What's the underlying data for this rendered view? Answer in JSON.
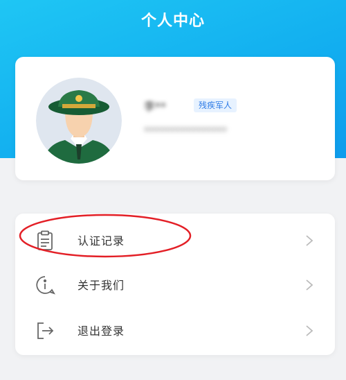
{
  "header": {
    "title": "个人中心"
  },
  "profile": {
    "name": "李**",
    "tag": "残疾军人",
    "id_number": "****************"
  },
  "menu": {
    "items": [
      {
        "label": "认证记录",
        "icon": "clipboard-icon"
      },
      {
        "label": "关于我们",
        "icon": "info-icon"
      },
      {
        "label": "退出登录",
        "icon": "logout-icon"
      }
    ]
  },
  "colors": {
    "header_gradient_start": "#1fc6f4",
    "header_gradient_end": "#0e9cec",
    "tag_text": "#2d7be6",
    "highlight": "#e31f26"
  }
}
